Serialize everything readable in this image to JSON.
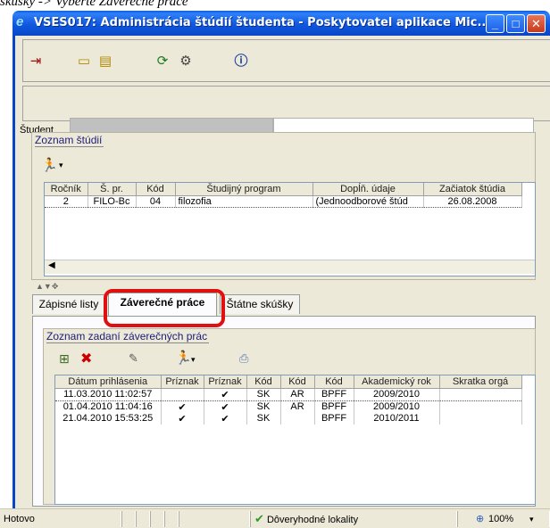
{
  "caption": "skúšky -> Vyberte Záverečné práce",
  "window": {
    "title": "VSES017: Administrácia štúdií študenta - Poskytovatel aplikace Mic...",
    "controls": [
      "_",
      "□",
      "✕"
    ]
  },
  "toolbar": {
    "icons": [
      "exit-icon",
      "note-icon",
      "notes-icon",
      "refresh-icon",
      "settings-icon",
      "info-icon"
    ]
  },
  "student": {
    "label": "Študent"
  },
  "studies": {
    "title": "Zoznam štúdií",
    "columns": [
      "Ročník",
      "Š. pr.",
      "Kód",
      "Študijný program",
      "Dopĺň. údaje",
      "Začiatok štúdia"
    ],
    "rows": [
      [
        "2",
        "FILO-Bc",
        "04",
        "filozofia",
        "(Jednoodborové štúd",
        "26.08.2008"
      ]
    ]
  },
  "tabs": [
    {
      "label": "Zápisné listy"
    },
    {
      "label": "Záverečné práce"
    },
    {
      "label": "Štátne skúšky"
    }
  ],
  "theses": {
    "title": "Zoznam zadaní záverečných prác",
    "columns": [
      "Dátum prihlásenia",
      "Príznak",
      "Príznak",
      "Kód",
      "Kód",
      "Kód",
      "Akademický rok",
      "Skratka orgá"
    ],
    "rows": [
      [
        "11.03.2010 11:02:57",
        "",
        "✔",
        "SK",
        "AR",
        "BPFF",
        "2009/2010",
        ""
      ],
      [
        "01.04.2010 11:04:16",
        "✔",
        "✔",
        "SK",
        "AR",
        "BPFF",
        "2009/2010",
        ""
      ],
      [
        "21.04.2010 15:53:25",
        "✔",
        "✔",
        "SK",
        "",
        "BPFF",
        "2010/2011",
        ""
      ]
    ]
  },
  "status": {
    "left": "Hotovo",
    "zone": "Dôveryhodné lokality",
    "zoom": "100%"
  }
}
